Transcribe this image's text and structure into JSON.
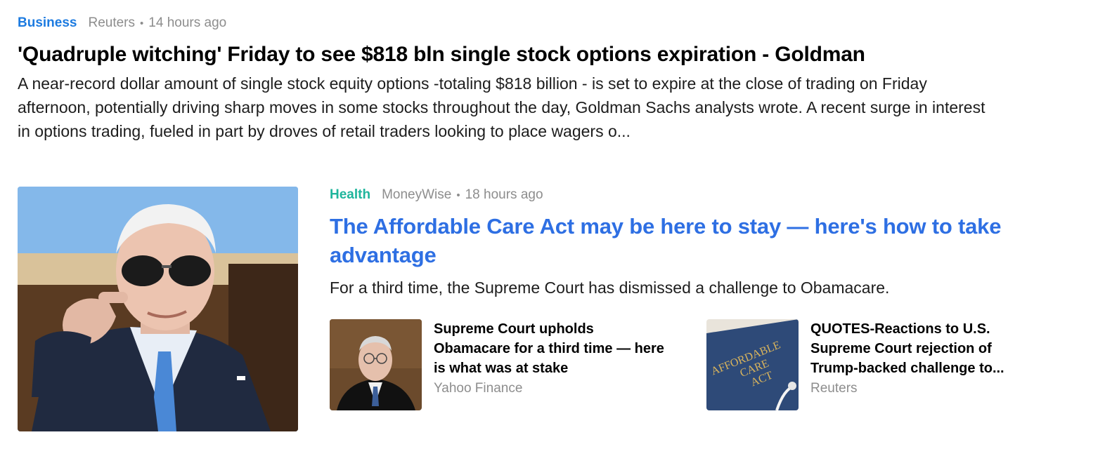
{
  "story1": {
    "category": "Business",
    "provider": "Reuters",
    "separator": "•",
    "time": "14 hours ago",
    "title": "'Quadruple witching' Friday to see $818 bln single stock options expiration - Goldman",
    "summary": "A near-record dollar amount of single stock equity options -totaling $818 billion - is set to expire at the close of trading on Friday afternoon, potentially driving sharp moves in some stocks throughout the day, Goldman Sachs analysts wrote. A recent surge in interest in options trading, fueled in part by droves of retail traders looking to place wagers o..."
  },
  "story2": {
    "category": "Health",
    "provider": "MoneyWise",
    "separator": "•",
    "time": "18 hours ago",
    "title": "The Affordable Care Act may be here to stay — here's how to take advantage",
    "summary": "For a third time, the Supreme Court has dismissed a challenge to Obamacare.",
    "related": [
      {
        "title": "Supreme Court upholds Obamacare for a third time — here is what was at stake",
        "source": "Yahoo Finance"
      },
      {
        "title": "QUOTES-Reactions to U.S. Supreme Court rejection of Trump-backed challenge to...",
        "source": "Reuters",
        "thumb_text": [
          "AFFORDABLE",
          "CARE",
          "ACT"
        ]
      }
    ]
  },
  "colors": {
    "business": "#1d7be0",
    "health": "#1fb59c",
    "link_title": "#2e6fe3",
    "meta_gray": "#8d8d8d"
  }
}
